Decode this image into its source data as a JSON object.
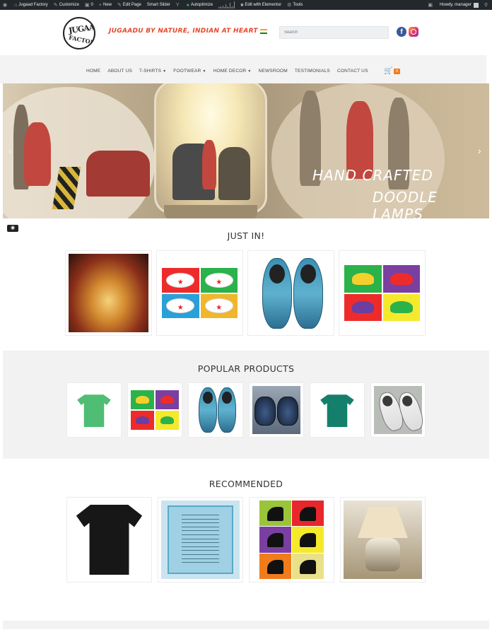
{
  "admin_bar": {
    "site_name": "Jugaad Factory",
    "customize": "Customize",
    "comments": "0",
    "new": "New",
    "edit_page": "Edit Page",
    "smart_slider": "Smart Slider",
    "autoptimize": "Autoptimize",
    "edit_elementor": "Edit with Elementor",
    "tools": "Tools",
    "howdy": "Howdy, manager"
  },
  "header": {
    "logo_line1": "JUGAAD",
    "logo_line2": "FACTORY",
    "tagline": "JUGAADU BY NATURE, INDIAN AT HEART",
    "search_placeholder": "Search",
    "facebook_glyph": "f"
  },
  "nav": {
    "items": [
      {
        "label": "HOME",
        "dropdown": false
      },
      {
        "label": "ABOUT US",
        "dropdown": false
      },
      {
        "label": "T-SHIRTS",
        "dropdown": true
      },
      {
        "label": "FOOTWEAR",
        "dropdown": true
      },
      {
        "label": "HOME DECOR",
        "dropdown": true
      },
      {
        "label": "NEWSROOM",
        "dropdown": false
      },
      {
        "label": "TESTIMONIALS",
        "dropdown": false
      },
      {
        "label": "CONTACT US",
        "dropdown": false
      }
    ],
    "cart_count": "0"
  },
  "slider": {
    "line1": "HAND CRAFTED",
    "line2": "DOODLE LAMPS"
  },
  "sections": {
    "just_in": "JUST IN!",
    "popular": "POPULAR PRODUCTS",
    "recommended": "RECOMMENDED"
  },
  "colors": {
    "tagline": "#e8462a",
    "admin_bar": "#23282d",
    "cart_badge": "#f07c1b",
    "nav_bg": "#f3f3f3"
  }
}
